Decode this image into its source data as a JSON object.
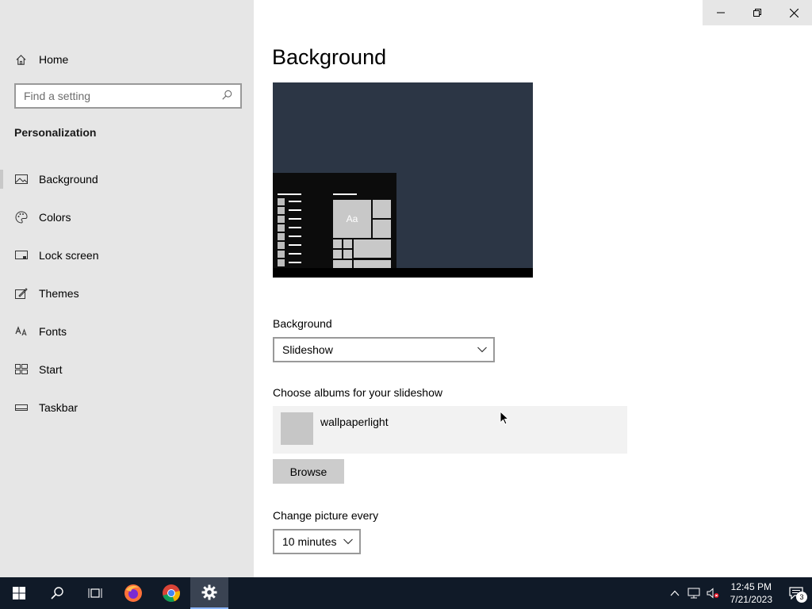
{
  "window": {
    "controls": [
      "minimize-icon",
      "restore-icon",
      "close-icon"
    ]
  },
  "sidebar": {
    "home_label": "Home",
    "search_placeholder": "Find a setting",
    "section_title": "Personalization",
    "items": [
      {
        "label": "Background",
        "icon": "picture-icon",
        "active": true
      },
      {
        "label": "Colors",
        "icon": "palette-icon",
        "active": false
      },
      {
        "label": "Lock screen",
        "icon": "lock-screen-icon",
        "active": false
      },
      {
        "label": "Themes",
        "icon": "brush-icon",
        "active": false
      },
      {
        "label": "Fonts",
        "icon": "fonts-icon",
        "active": false
      },
      {
        "label": "Start",
        "icon": "start-tiles-icon",
        "active": false
      },
      {
        "label": "Taskbar",
        "icon": "taskbar-icon",
        "active": false
      }
    ]
  },
  "main": {
    "title": "Background",
    "preview": {
      "tile_text": "Aa"
    },
    "background_label": "Background",
    "background_value": "Slideshow",
    "albums_label": "Choose albums for your slideshow",
    "album_name": "wallpaperlight",
    "browse_label": "Browse",
    "change_label": "Change picture every",
    "change_value": "10 minutes"
  },
  "taskbar": {
    "apps": [
      "windows-start-icon",
      "search-icon",
      "task-view-icon",
      "firefox-icon",
      "chrome-icon",
      "settings-icon"
    ],
    "active_app": "settings-icon",
    "time": "12:45 PM",
    "date": "7/21/2023",
    "notification_count": "3"
  }
}
